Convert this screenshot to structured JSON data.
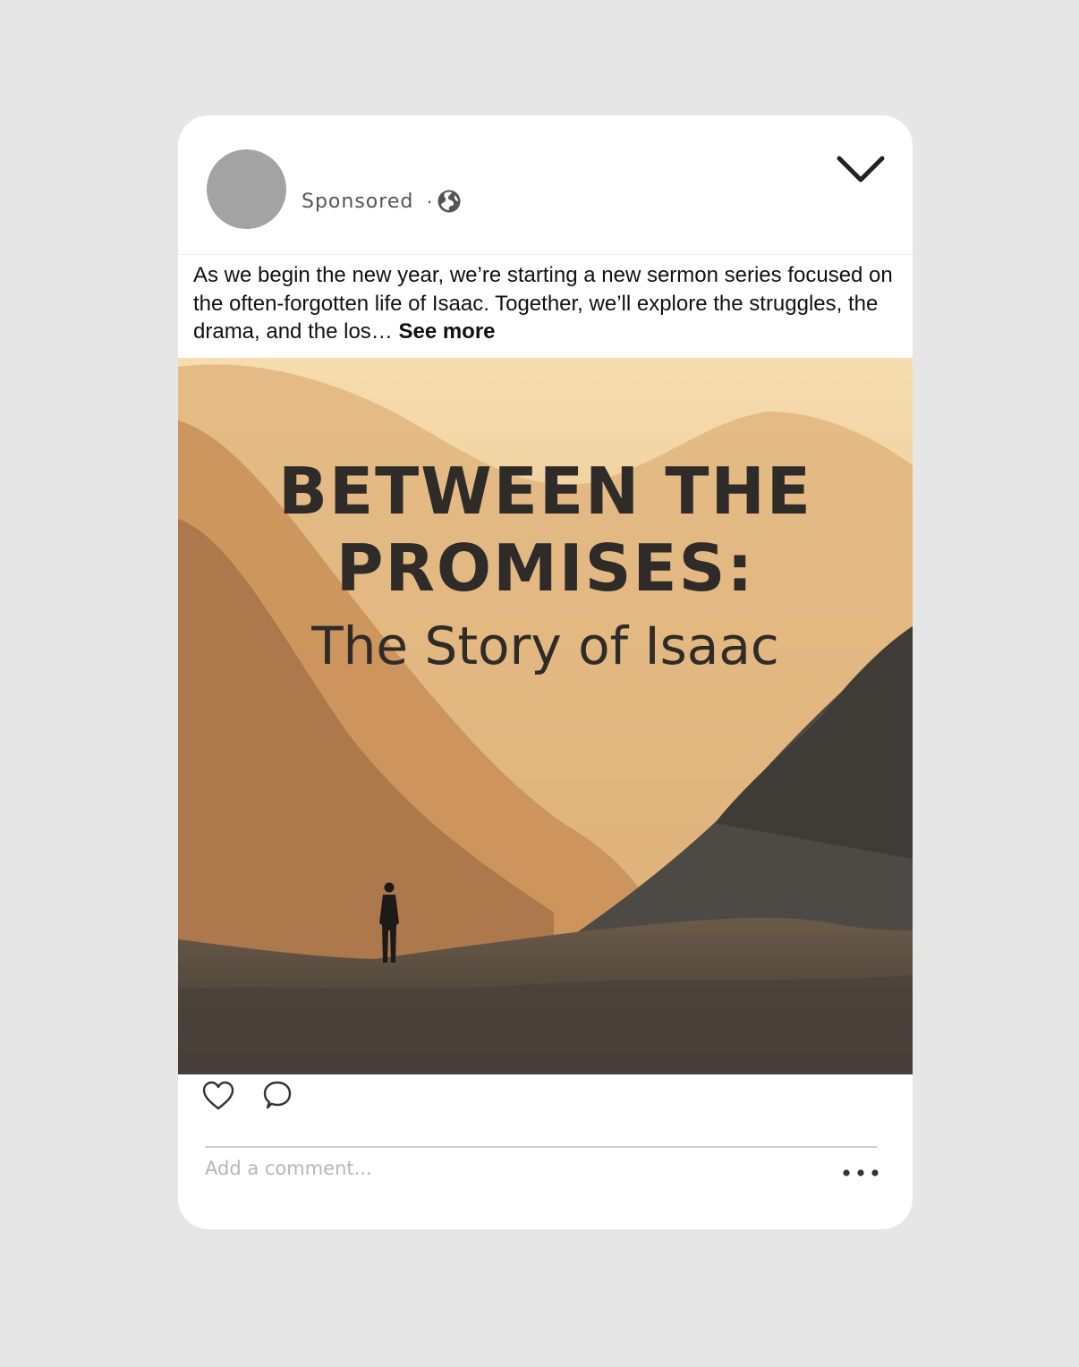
{
  "post": {
    "sponsored_label": "Sponsored",
    "separator": "·",
    "caption_text": "As we begin the new year, we’re starting a new sermon series focused on the often-forgotten life of Isaac. Together, we’ll explore the struggles, the drama, and the los…",
    "see_more_label": "See more"
  },
  "hero": {
    "title": "BETWEEN THE PROMISES:",
    "subtitle": "The Story of Isaac"
  },
  "comment": {
    "placeholder": "Add a comment..."
  },
  "icons": {
    "privacy": "globe-icon",
    "menu": "chevron-down-icon",
    "like": "heart-icon",
    "comment": "comment-bubble-icon",
    "more": "more-dots-icon"
  },
  "colors": {
    "page_background": "#e6e6e6",
    "card": "#ffffff",
    "avatar": "#a3a3a3",
    "title_text": "#2e2b28"
  }
}
